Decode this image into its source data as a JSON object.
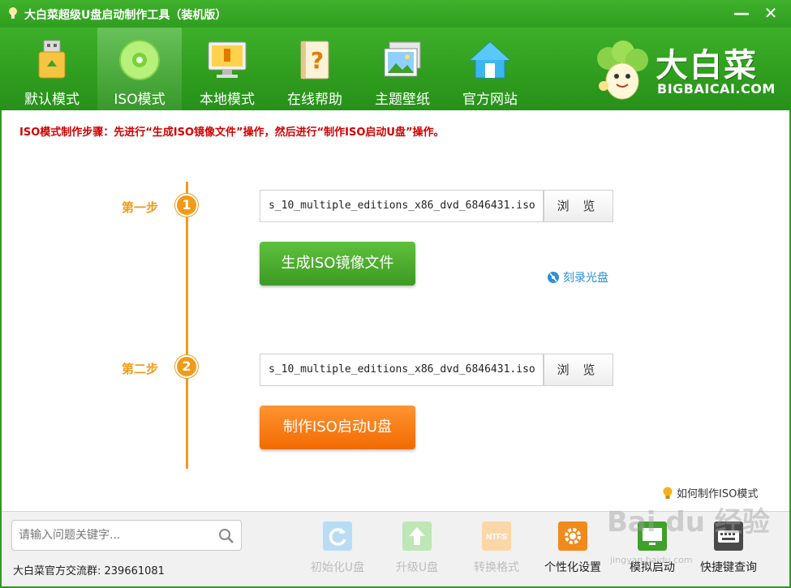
{
  "window": {
    "title": "大白菜超级U盘启动制作工具（装机版）",
    "minimize_label": "—",
    "close_label": "✕"
  },
  "toolbar": {
    "items": [
      {
        "label": "默认模式",
        "icon": "usb-drive-icon"
      },
      {
        "label": "ISO模式",
        "icon": "disc-icon",
        "active": true
      },
      {
        "label": "本地模式",
        "icon": "monitor-icon"
      },
      {
        "label": "在线帮助",
        "icon": "help-book-icon"
      },
      {
        "label": "主题壁纸",
        "icon": "wallpaper-icon"
      },
      {
        "label": "官方网站",
        "icon": "home-icon"
      }
    ]
  },
  "brand": {
    "name_cn": "大白菜",
    "name_en": "BIGBAICAI.COM"
  },
  "main": {
    "hint": "ISO模式制作步骤：先进行“生成ISO镜像文件”操作，然后进行“制作ISO启动U盘”操作。",
    "step1": {
      "label": "第一步",
      "number": "1",
      "path": "s_10_multiple_editions_x86_dvd_6846431.iso",
      "browse_label": "浏 览",
      "action_label": "生成ISO镜像文件"
    },
    "burn_link": "刻录光盘",
    "step2": {
      "label": "第二步",
      "number": "2",
      "path": "s_10_multiple_editions_x86_dvd_6846431.iso",
      "browse_label": "浏 览",
      "action_label": "制作ISO启动U盘"
    },
    "howto_link": "如何制作ISO模式"
  },
  "bottom": {
    "search_placeholder": "请输入问题关键字...",
    "qq_group": "大白菜官方交流群: 239661081",
    "tools": [
      {
        "label": "初始化U盘",
        "enabled": false,
        "icon": "refresh-icon"
      },
      {
        "label": "升级U盘",
        "enabled": false,
        "icon": "upgrade-icon"
      },
      {
        "label": "转换格式",
        "enabled": false,
        "icon": "ntfs-icon",
        "icon_text": "NTFS"
      },
      {
        "label": "个性化设置",
        "enabled": true,
        "icon": "settings-icon"
      },
      {
        "label": "模拟启动",
        "enabled": true,
        "icon": "simulate-boot-icon"
      },
      {
        "label": "快捷键查询",
        "enabled": true,
        "icon": "keyboard-icon"
      }
    ]
  },
  "watermark": {
    "text": "Bai du 经验",
    "sub": "jingyan.baidu.com"
  },
  "colors": {
    "brand_green": "#2f9a1f",
    "accent_orange": "#f29b18",
    "hint_red": "#d00000",
    "link_blue": "#2d8fd8"
  }
}
